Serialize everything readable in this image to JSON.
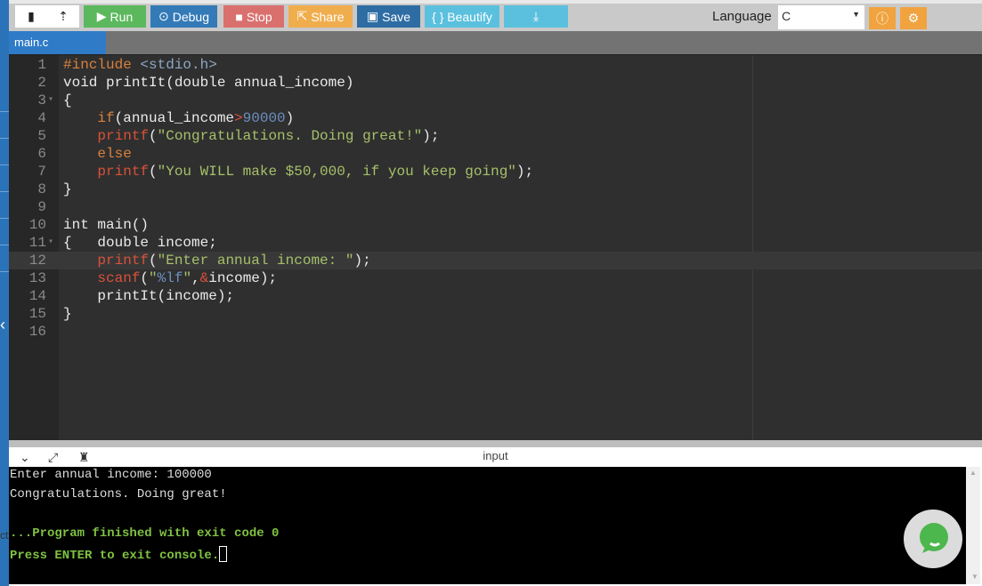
{
  "toolbar": {
    "new_file": "new-file",
    "upload": "upload",
    "run": "Run",
    "debug": "Debug",
    "stop": "Stop",
    "share": "Share",
    "save": "Save",
    "beautify": "{ } Beautify",
    "download": "download",
    "language_label": "Language",
    "language_value": "C"
  },
  "colors": {
    "run": "#5cb85c",
    "debug": "#337ab7",
    "stop": "#d9706e",
    "share": "#f0ad4e",
    "save": "#2e6da4",
    "beautify": "#5bc0de",
    "orange": "#f0a33f"
  },
  "tabs": [
    {
      "label": "main.c"
    }
  ],
  "editor": {
    "active_line": 12,
    "lines": [
      [
        [
          "t-pre",
          "#include "
        ],
        [
          "t-inc",
          "<stdio.h>"
        ]
      ],
      [
        [
          "t-plain",
          "void printIt(double annual_income)"
        ]
      ],
      [
        [
          "t-plain",
          "{"
        ]
      ],
      [
        [
          "t-plain",
          "    "
        ],
        [
          "t-kw",
          "if"
        ],
        [
          "t-plain",
          "(annual_income"
        ],
        [
          "t-op",
          ">"
        ],
        [
          "t-num",
          "90000"
        ],
        [
          "t-plain",
          ")"
        ]
      ],
      [
        [
          "t-plain",
          "    "
        ],
        [
          "t-fn",
          "printf"
        ],
        [
          "t-plain",
          "("
        ],
        [
          "t-str",
          "\"Congratulations. Doing great!\""
        ],
        [
          "t-plain",
          ");"
        ]
      ],
      [
        [
          "t-plain",
          "    "
        ],
        [
          "t-kw",
          "else"
        ]
      ],
      [
        [
          "t-plain",
          "    "
        ],
        [
          "t-fn",
          "printf"
        ],
        [
          "t-plain",
          "("
        ],
        [
          "t-str",
          "\"You WILL make $50,000, if you keep going\""
        ],
        [
          "t-plain",
          ");"
        ]
      ],
      [
        [
          "t-plain",
          "}"
        ]
      ],
      [],
      [
        [
          "t-plain",
          "int main()"
        ]
      ],
      [
        [
          "t-plain",
          "{   double income;"
        ]
      ],
      [
        [
          "t-plain",
          "    "
        ],
        [
          "t-fn",
          "printf"
        ],
        [
          "t-plain",
          "("
        ],
        [
          "t-str",
          "\"Enter annual income: \""
        ],
        [
          "t-plain",
          ");"
        ]
      ],
      [
        [
          "t-plain",
          "    "
        ],
        [
          "t-fn",
          "scanf"
        ],
        [
          "t-plain",
          "("
        ],
        [
          "t-str",
          "\""
        ],
        [
          "t-fmt",
          "%lf"
        ],
        [
          "t-str",
          "\""
        ],
        [
          "t-plain",
          ","
        ],
        [
          "t-op",
          "&"
        ],
        [
          "t-plain",
          "income);"
        ]
      ],
      [
        [
          "t-plain",
          "    printIt(income);"
        ]
      ],
      [
        [
          "t-plain",
          "}"
        ]
      ],
      []
    ],
    "fold_lines": [
      3,
      11
    ]
  },
  "console": {
    "title": "input",
    "lines": [
      {
        "text": "Enter annual income: 100000",
        "style": "normal"
      },
      {
        "text": "Congratulations. Doing great!",
        "style": "normal"
      },
      {
        "text": "",
        "style": "normal"
      },
      {
        "text": "...Program finished with exit code 0",
        "style": "green"
      },
      {
        "text": "Press ENTER to exit console.",
        "style": "green"
      }
    ]
  },
  "side": {
    "text": "ct"
  }
}
